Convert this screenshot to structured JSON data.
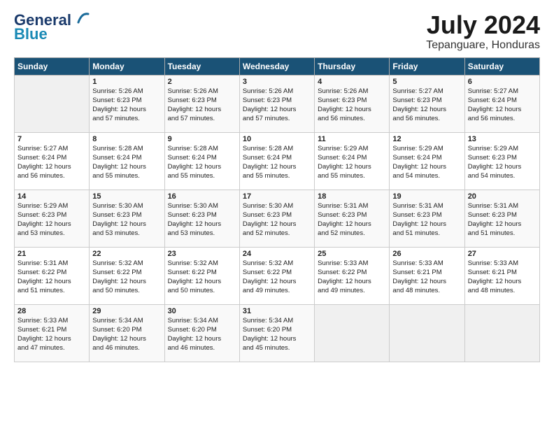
{
  "logo": {
    "line1": "General",
    "line2": "Blue"
  },
  "title": "July 2024",
  "location": "Tepanguare, Honduras",
  "headers": [
    "Sunday",
    "Monday",
    "Tuesday",
    "Wednesday",
    "Thursday",
    "Friday",
    "Saturday"
  ],
  "weeks": [
    [
      {
        "day": "",
        "info": ""
      },
      {
        "day": "1",
        "info": "Sunrise: 5:26 AM\nSunset: 6:23 PM\nDaylight: 12 hours\nand 57 minutes."
      },
      {
        "day": "2",
        "info": "Sunrise: 5:26 AM\nSunset: 6:23 PM\nDaylight: 12 hours\nand 57 minutes."
      },
      {
        "day": "3",
        "info": "Sunrise: 5:26 AM\nSunset: 6:23 PM\nDaylight: 12 hours\nand 57 minutes."
      },
      {
        "day": "4",
        "info": "Sunrise: 5:26 AM\nSunset: 6:23 PM\nDaylight: 12 hours\nand 56 minutes."
      },
      {
        "day": "5",
        "info": "Sunrise: 5:27 AM\nSunset: 6:23 PM\nDaylight: 12 hours\nand 56 minutes."
      },
      {
        "day": "6",
        "info": "Sunrise: 5:27 AM\nSunset: 6:24 PM\nDaylight: 12 hours\nand 56 minutes."
      }
    ],
    [
      {
        "day": "7",
        "info": "Sunrise: 5:27 AM\nSunset: 6:24 PM\nDaylight: 12 hours\nand 56 minutes."
      },
      {
        "day": "8",
        "info": "Sunrise: 5:28 AM\nSunset: 6:24 PM\nDaylight: 12 hours\nand 55 minutes."
      },
      {
        "day": "9",
        "info": "Sunrise: 5:28 AM\nSunset: 6:24 PM\nDaylight: 12 hours\nand 55 minutes."
      },
      {
        "day": "10",
        "info": "Sunrise: 5:28 AM\nSunset: 6:24 PM\nDaylight: 12 hours\nand 55 minutes."
      },
      {
        "day": "11",
        "info": "Sunrise: 5:29 AM\nSunset: 6:24 PM\nDaylight: 12 hours\nand 55 minutes."
      },
      {
        "day": "12",
        "info": "Sunrise: 5:29 AM\nSunset: 6:24 PM\nDaylight: 12 hours\nand 54 minutes."
      },
      {
        "day": "13",
        "info": "Sunrise: 5:29 AM\nSunset: 6:23 PM\nDaylight: 12 hours\nand 54 minutes."
      }
    ],
    [
      {
        "day": "14",
        "info": "Sunrise: 5:29 AM\nSunset: 6:23 PM\nDaylight: 12 hours\nand 53 minutes."
      },
      {
        "day": "15",
        "info": "Sunrise: 5:30 AM\nSunset: 6:23 PM\nDaylight: 12 hours\nand 53 minutes."
      },
      {
        "day": "16",
        "info": "Sunrise: 5:30 AM\nSunset: 6:23 PM\nDaylight: 12 hours\nand 53 minutes."
      },
      {
        "day": "17",
        "info": "Sunrise: 5:30 AM\nSunset: 6:23 PM\nDaylight: 12 hours\nand 52 minutes."
      },
      {
        "day": "18",
        "info": "Sunrise: 5:31 AM\nSunset: 6:23 PM\nDaylight: 12 hours\nand 52 minutes."
      },
      {
        "day": "19",
        "info": "Sunrise: 5:31 AM\nSunset: 6:23 PM\nDaylight: 12 hours\nand 51 minutes."
      },
      {
        "day": "20",
        "info": "Sunrise: 5:31 AM\nSunset: 6:23 PM\nDaylight: 12 hours\nand 51 minutes."
      }
    ],
    [
      {
        "day": "21",
        "info": "Sunrise: 5:31 AM\nSunset: 6:22 PM\nDaylight: 12 hours\nand 51 minutes."
      },
      {
        "day": "22",
        "info": "Sunrise: 5:32 AM\nSunset: 6:22 PM\nDaylight: 12 hours\nand 50 minutes."
      },
      {
        "day": "23",
        "info": "Sunrise: 5:32 AM\nSunset: 6:22 PM\nDaylight: 12 hours\nand 50 minutes."
      },
      {
        "day": "24",
        "info": "Sunrise: 5:32 AM\nSunset: 6:22 PM\nDaylight: 12 hours\nand 49 minutes."
      },
      {
        "day": "25",
        "info": "Sunrise: 5:33 AM\nSunset: 6:22 PM\nDaylight: 12 hours\nand 49 minutes."
      },
      {
        "day": "26",
        "info": "Sunrise: 5:33 AM\nSunset: 6:21 PM\nDaylight: 12 hours\nand 48 minutes."
      },
      {
        "day": "27",
        "info": "Sunrise: 5:33 AM\nSunset: 6:21 PM\nDaylight: 12 hours\nand 48 minutes."
      }
    ],
    [
      {
        "day": "28",
        "info": "Sunrise: 5:33 AM\nSunset: 6:21 PM\nDaylight: 12 hours\nand 47 minutes."
      },
      {
        "day": "29",
        "info": "Sunrise: 5:34 AM\nSunset: 6:20 PM\nDaylight: 12 hours\nand 46 minutes."
      },
      {
        "day": "30",
        "info": "Sunrise: 5:34 AM\nSunset: 6:20 PM\nDaylight: 12 hours\nand 46 minutes."
      },
      {
        "day": "31",
        "info": "Sunrise: 5:34 AM\nSunset: 6:20 PM\nDaylight: 12 hours\nand 45 minutes."
      },
      {
        "day": "",
        "info": ""
      },
      {
        "day": "",
        "info": ""
      },
      {
        "day": "",
        "info": ""
      }
    ]
  ]
}
